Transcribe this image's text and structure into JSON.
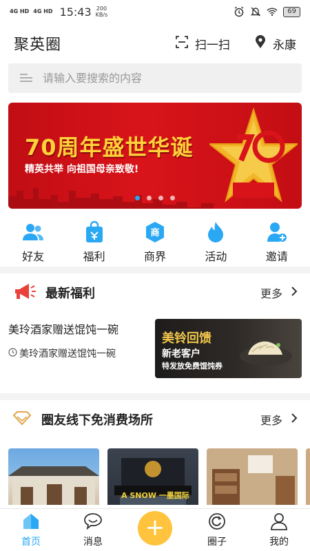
{
  "status_bar": {
    "network1": "4G HD",
    "network2": "4G HD",
    "time": "15:43",
    "speed_value": "200",
    "speed_unit": "KB/s",
    "battery": "69"
  },
  "header": {
    "logo": "聚英圈",
    "scan_label": "扫一扫",
    "location_label": "永康"
  },
  "search": {
    "placeholder": "请输入要搜索的内容"
  },
  "banner": {
    "title": "70周年盛世华诞",
    "subtitle": "精英共举  向祖国母亲致敬!",
    "slide_count": 4,
    "active_slide": 1
  },
  "categories": [
    {
      "label": "好友",
      "icon": "friends-icon"
    },
    {
      "label": "福利",
      "icon": "gift-bag-icon"
    },
    {
      "label": "商界",
      "icon": "business-icon"
    },
    {
      "label": "活动",
      "icon": "flame-icon"
    },
    {
      "label": "邀请",
      "icon": "invite-user-icon"
    }
  ],
  "welfare_section": {
    "title": "最新福利",
    "more": "更多",
    "item": {
      "title": "美玲酒家赠送馄饨一碗",
      "shop": "美玲酒家赠送馄饨一碗",
      "image_line1": "美铃回馈",
      "image_line2": "新老客户",
      "image_line3": "特发放免费馄饨券"
    }
  },
  "places_section": {
    "title": "圈友线下免消费场所",
    "more": "更多",
    "place2_sign": "A SNOW 一墨国际"
  },
  "tabbar": [
    {
      "label": "首页",
      "icon": "home-icon",
      "active": true
    },
    {
      "label": "消息",
      "icon": "message-icon",
      "active": false
    },
    {
      "label": "+",
      "icon": "plus-icon",
      "active": false
    },
    {
      "label": "圈子",
      "icon": "circle-icon",
      "active": false
    },
    {
      "label": "我的",
      "icon": "profile-icon",
      "active": false
    }
  ],
  "colors": {
    "accent": "#2ba8f3",
    "banner_red": "#d8141a",
    "banner_gold": "#ffd23a",
    "plus_button": "#ffc33d"
  }
}
